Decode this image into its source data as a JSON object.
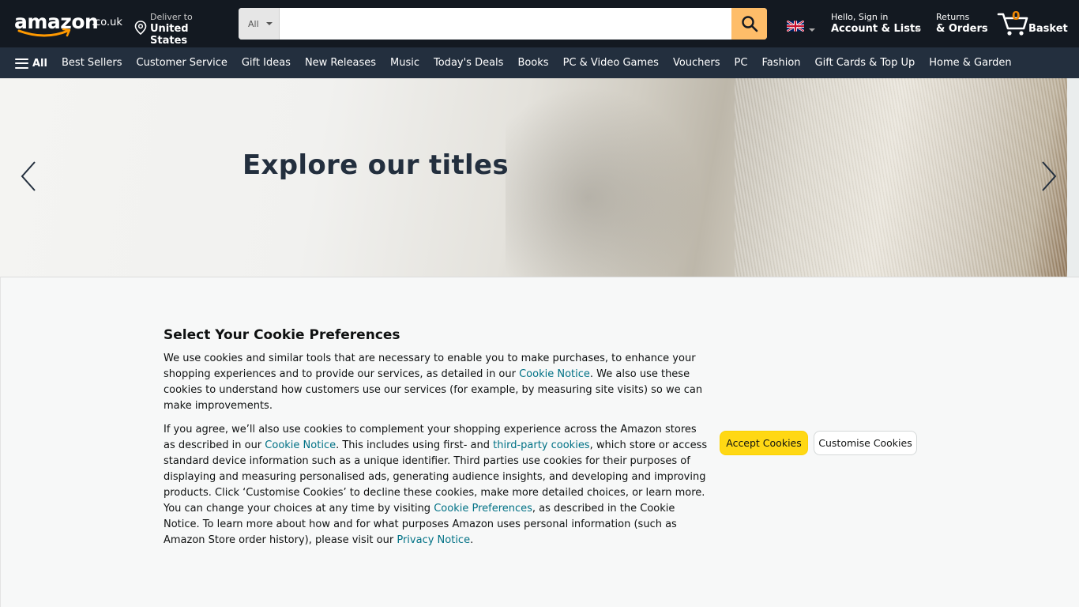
{
  "header": {
    "logo_text": "amazon",
    "logo_tld": ".co.uk",
    "deliver": {
      "line1": "Deliver to",
      "line2": "United States"
    },
    "search": {
      "category": "All",
      "placeholder": ""
    },
    "account": {
      "line1": "Hello, Sign in",
      "line2": "Account & Lists"
    },
    "returns": {
      "line1": "Returns",
      "line2": "& Orders"
    },
    "basket": {
      "count": "0",
      "label": "Basket"
    }
  },
  "subnav": {
    "all_label": "All",
    "items": [
      "Best Sellers",
      "Customer Service",
      "Gift Ideas",
      "New Releases",
      "Music",
      "Today's Deals",
      "Books",
      "PC & Video Games",
      "Vouchers",
      "PC",
      "Fashion",
      "Gift Cards & Top Up",
      "Home & Garden"
    ]
  },
  "hero": {
    "title": "Explore our titles"
  },
  "cookie": {
    "title": "Select Your Cookie Preferences",
    "p1": {
      "a": "We use cookies and similar tools that are necessary to enable you to make purchases, to enhance your shopping experiences and to provide our services, as detailed in our ",
      "link1": "Cookie Notice",
      "b": ". We also use these cookies to understand how customers use our services (for example, by measuring site visits) so we can make improvements."
    },
    "p2": {
      "a": "If you agree, we’ll also use cookies to complement your shopping experience across the Amazon stores as described in our ",
      "link1": "Cookie Notice",
      "b": ". This includes using first- and ",
      "link2": "third-party cookies",
      "c": ", which store or access standard device information such as a unique identifier. Third parties use cookies for their purposes of displaying and measuring personalised ads, generating audience insights, and developing and improving products. Click ‘Customise Cookies’ to decline these cookies, make more detailed choices, or learn more. You can change your choices at any time by visiting ",
      "link3": "Cookie Preferences",
      "d": ", as described in the Cookie Notice. To learn more about how and for what purposes Amazon uses personal information (such as Amazon Store order history), please visit our ",
      "link4": "Privacy Notice",
      "e": "."
    },
    "accept_label": "Accept Cookies",
    "customise_label": "Customise Cookies"
  },
  "colors": {
    "nav_dark": "#131921",
    "nav_sub": "#232f3e",
    "search_button": "#febd69",
    "accept_button": "#ffd814",
    "link": "#007185",
    "basket_count": "#f08804"
  },
  "icons": [
    "location-pin-icon",
    "search-icon",
    "uk-flag-icon",
    "cart-icon",
    "menu-icon",
    "chevron-left-icon",
    "chevron-right-icon"
  ]
}
